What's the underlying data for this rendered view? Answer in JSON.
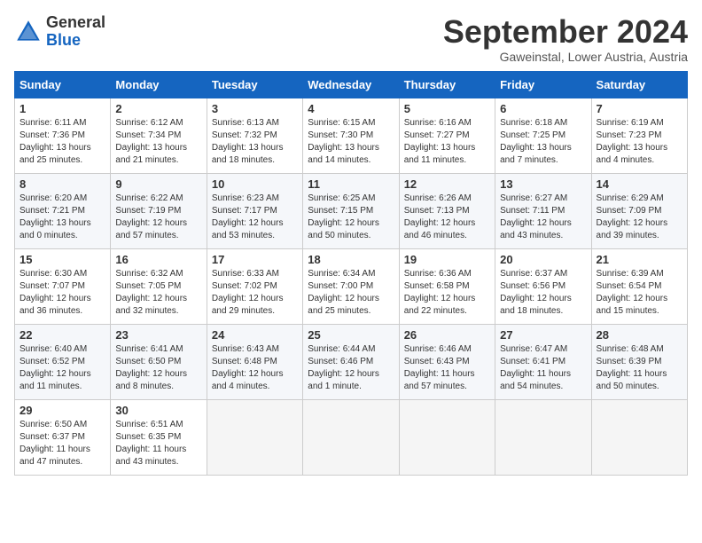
{
  "header": {
    "logo_general": "General",
    "logo_blue": "Blue",
    "month_title": "September 2024",
    "location": "Gaweinstal, Lower Austria, Austria"
  },
  "weekdays": [
    "Sunday",
    "Monday",
    "Tuesday",
    "Wednesday",
    "Thursday",
    "Friday",
    "Saturday"
  ],
  "weeks": [
    [
      {
        "day": "1",
        "lines": [
          "Sunrise: 6:11 AM",
          "Sunset: 7:36 PM",
          "Daylight: 13 hours",
          "and 25 minutes."
        ]
      },
      {
        "day": "2",
        "lines": [
          "Sunrise: 6:12 AM",
          "Sunset: 7:34 PM",
          "Daylight: 13 hours",
          "and 21 minutes."
        ]
      },
      {
        "day": "3",
        "lines": [
          "Sunrise: 6:13 AM",
          "Sunset: 7:32 PM",
          "Daylight: 13 hours",
          "and 18 minutes."
        ]
      },
      {
        "day": "4",
        "lines": [
          "Sunrise: 6:15 AM",
          "Sunset: 7:30 PM",
          "Daylight: 13 hours",
          "and 14 minutes."
        ]
      },
      {
        "day": "5",
        "lines": [
          "Sunrise: 6:16 AM",
          "Sunset: 7:27 PM",
          "Daylight: 13 hours",
          "and 11 minutes."
        ]
      },
      {
        "day": "6",
        "lines": [
          "Sunrise: 6:18 AM",
          "Sunset: 7:25 PM",
          "Daylight: 13 hours",
          "and 7 minutes."
        ]
      },
      {
        "day": "7",
        "lines": [
          "Sunrise: 6:19 AM",
          "Sunset: 7:23 PM",
          "Daylight: 13 hours",
          "and 4 minutes."
        ]
      }
    ],
    [
      {
        "day": "8",
        "lines": [
          "Sunrise: 6:20 AM",
          "Sunset: 7:21 PM",
          "Daylight: 13 hours",
          "and 0 minutes."
        ]
      },
      {
        "day": "9",
        "lines": [
          "Sunrise: 6:22 AM",
          "Sunset: 7:19 PM",
          "Daylight: 12 hours",
          "and 57 minutes."
        ]
      },
      {
        "day": "10",
        "lines": [
          "Sunrise: 6:23 AM",
          "Sunset: 7:17 PM",
          "Daylight: 12 hours",
          "and 53 minutes."
        ]
      },
      {
        "day": "11",
        "lines": [
          "Sunrise: 6:25 AM",
          "Sunset: 7:15 PM",
          "Daylight: 12 hours",
          "and 50 minutes."
        ]
      },
      {
        "day": "12",
        "lines": [
          "Sunrise: 6:26 AM",
          "Sunset: 7:13 PM",
          "Daylight: 12 hours",
          "and 46 minutes."
        ]
      },
      {
        "day": "13",
        "lines": [
          "Sunrise: 6:27 AM",
          "Sunset: 7:11 PM",
          "Daylight: 12 hours",
          "and 43 minutes."
        ]
      },
      {
        "day": "14",
        "lines": [
          "Sunrise: 6:29 AM",
          "Sunset: 7:09 PM",
          "Daylight: 12 hours",
          "and 39 minutes."
        ]
      }
    ],
    [
      {
        "day": "15",
        "lines": [
          "Sunrise: 6:30 AM",
          "Sunset: 7:07 PM",
          "Daylight: 12 hours",
          "and 36 minutes."
        ]
      },
      {
        "day": "16",
        "lines": [
          "Sunrise: 6:32 AM",
          "Sunset: 7:05 PM",
          "Daylight: 12 hours",
          "and 32 minutes."
        ]
      },
      {
        "day": "17",
        "lines": [
          "Sunrise: 6:33 AM",
          "Sunset: 7:02 PM",
          "Daylight: 12 hours",
          "and 29 minutes."
        ]
      },
      {
        "day": "18",
        "lines": [
          "Sunrise: 6:34 AM",
          "Sunset: 7:00 PM",
          "Daylight: 12 hours",
          "and 25 minutes."
        ]
      },
      {
        "day": "19",
        "lines": [
          "Sunrise: 6:36 AM",
          "Sunset: 6:58 PM",
          "Daylight: 12 hours",
          "and 22 minutes."
        ]
      },
      {
        "day": "20",
        "lines": [
          "Sunrise: 6:37 AM",
          "Sunset: 6:56 PM",
          "Daylight: 12 hours",
          "and 18 minutes."
        ]
      },
      {
        "day": "21",
        "lines": [
          "Sunrise: 6:39 AM",
          "Sunset: 6:54 PM",
          "Daylight: 12 hours",
          "and 15 minutes."
        ]
      }
    ],
    [
      {
        "day": "22",
        "lines": [
          "Sunrise: 6:40 AM",
          "Sunset: 6:52 PM",
          "Daylight: 12 hours",
          "and 11 minutes."
        ]
      },
      {
        "day": "23",
        "lines": [
          "Sunrise: 6:41 AM",
          "Sunset: 6:50 PM",
          "Daylight: 12 hours",
          "and 8 minutes."
        ]
      },
      {
        "day": "24",
        "lines": [
          "Sunrise: 6:43 AM",
          "Sunset: 6:48 PM",
          "Daylight: 12 hours",
          "and 4 minutes."
        ]
      },
      {
        "day": "25",
        "lines": [
          "Sunrise: 6:44 AM",
          "Sunset: 6:46 PM",
          "Daylight: 12 hours",
          "and 1 minute."
        ]
      },
      {
        "day": "26",
        "lines": [
          "Sunrise: 6:46 AM",
          "Sunset: 6:43 PM",
          "Daylight: 11 hours",
          "and 57 minutes."
        ]
      },
      {
        "day": "27",
        "lines": [
          "Sunrise: 6:47 AM",
          "Sunset: 6:41 PM",
          "Daylight: 11 hours",
          "and 54 minutes."
        ]
      },
      {
        "day": "28",
        "lines": [
          "Sunrise: 6:48 AM",
          "Sunset: 6:39 PM",
          "Daylight: 11 hours",
          "and 50 minutes."
        ]
      }
    ],
    [
      {
        "day": "29",
        "lines": [
          "Sunrise: 6:50 AM",
          "Sunset: 6:37 PM",
          "Daylight: 11 hours",
          "and 47 minutes."
        ]
      },
      {
        "day": "30",
        "lines": [
          "Sunrise: 6:51 AM",
          "Sunset: 6:35 PM",
          "Daylight: 11 hours",
          "and 43 minutes."
        ]
      },
      {
        "day": "",
        "lines": []
      },
      {
        "day": "",
        "lines": []
      },
      {
        "day": "",
        "lines": []
      },
      {
        "day": "",
        "lines": []
      },
      {
        "day": "",
        "lines": []
      }
    ]
  ]
}
